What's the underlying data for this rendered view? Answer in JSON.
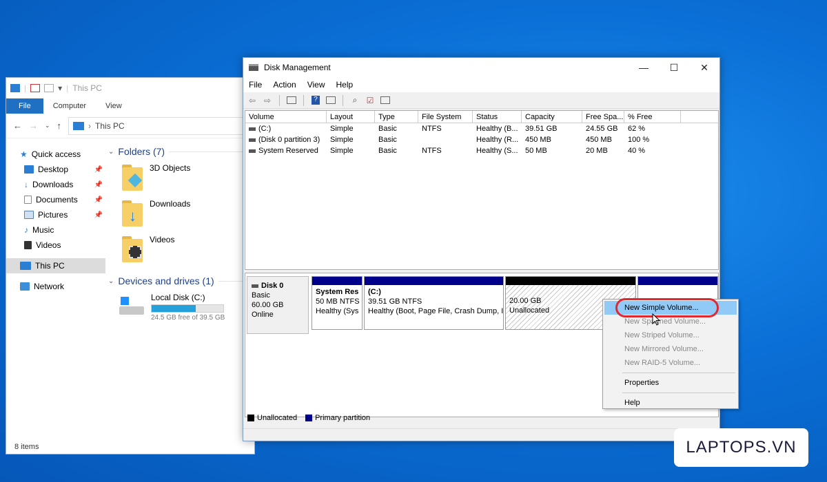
{
  "explorer": {
    "title": "This PC",
    "ribbon_tabs": [
      "File",
      "Computer",
      "View"
    ],
    "address": "This PC",
    "nav": {
      "quick_access": "Quick access",
      "items": [
        {
          "label": "Desktop",
          "icon": "desktop-icon"
        },
        {
          "label": "Downloads",
          "icon": "downloads-icon"
        },
        {
          "label": "Documents",
          "icon": "documents-icon"
        },
        {
          "label": "Pictures",
          "icon": "pictures-icon"
        },
        {
          "label": "Music",
          "icon": "music-icon"
        },
        {
          "label": "Videos",
          "icon": "videos-icon"
        }
      ],
      "this_pc": "This PC",
      "network": "Network"
    },
    "folders_header": "Folders (7)",
    "folders": [
      "3D Objects",
      "Downloads",
      "Videos"
    ],
    "devices_header": "Devices and drives (1)",
    "drive": {
      "name": "Local Disk (C:)",
      "free_text": "24.5 GB free of 39.5 GB",
      "used_fraction": 0.62
    },
    "status": "8 items"
  },
  "disk_mgmt": {
    "title": "Disk Management",
    "menu": [
      "File",
      "Action",
      "View",
      "Help"
    ],
    "columns": [
      "Volume",
      "Layout",
      "Type",
      "File System",
      "Status",
      "Capacity",
      "Free Spa...",
      "% Free"
    ],
    "rows": [
      [
        "(C:)",
        "Simple",
        "Basic",
        "NTFS",
        "Healthy (B...",
        "39.51 GB",
        "24.55 GB",
        "62 %"
      ],
      [
        "(Disk 0 partition 3)",
        "Simple",
        "Basic",
        "",
        "Healthy (R...",
        "450 MB",
        "450 MB",
        "100 %"
      ],
      [
        "System Reserved",
        "Simple",
        "Basic",
        "NTFS",
        "Healthy (S...",
        "50 MB",
        "20 MB",
        "40 %"
      ]
    ],
    "disk": {
      "name": "Disk 0",
      "type": "Basic",
      "size": "60.00 GB",
      "state": "Online"
    },
    "partitions": {
      "system_reserved": {
        "name": "System Res",
        "size": "50 MB NTFS",
        "status": "Healthy (Sys"
      },
      "c": {
        "name": "(C:)",
        "size": "39.51 GB NTFS",
        "status": "Healthy (Boot, Page File, Crash Dump, I"
      },
      "unalloc": {
        "size": "20.00 GB",
        "status": "Unallocated"
      }
    },
    "legend": [
      "Unallocated",
      "Primary partition"
    ],
    "colors": {
      "primary": "#00008b",
      "unallocated": "#000000"
    }
  },
  "context_menu": {
    "items": [
      {
        "label": "New Simple Volume...",
        "enabled": true
      },
      {
        "label": "New Spanned Volume...",
        "enabled": false
      },
      {
        "label": "New Striped Volume...",
        "enabled": false
      },
      {
        "label": "New Mirrored Volume...",
        "enabled": false
      },
      {
        "label": "New RAID-5 Volume...",
        "enabled": false
      },
      {
        "label": "Properties",
        "enabled": true
      },
      {
        "label": "Help",
        "enabled": true
      }
    ]
  },
  "logo": "LAPTOPS.VN"
}
